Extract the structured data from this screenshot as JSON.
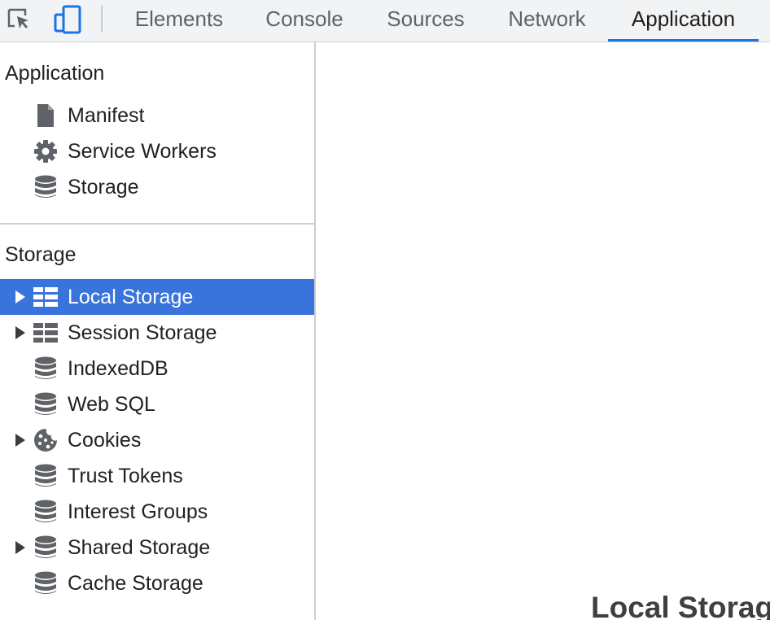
{
  "toolbar": {
    "tabs": [
      {
        "label": "Elements"
      },
      {
        "label": "Console"
      },
      {
        "label": "Sources"
      },
      {
        "label": "Network"
      },
      {
        "label": "Application"
      }
    ],
    "active_tab": "Application",
    "icons": {
      "inspect": "inspect-element-icon",
      "device": "device-toolbar-icon"
    },
    "accent_color": "#1a73e8"
  },
  "sidebar": {
    "application": {
      "title": "Application",
      "items": [
        {
          "label": "Manifest",
          "icon": "document-icon"
        },
        {
          "label": "Service Workers",
          "icon": "gear-icon"
        },
        {
          "label": "Storage",
          "icon": "database-icon"
        }
      ]
    },
    "storage": {
      "title": "Storage",
      "items": [
        {
          "label": "Local Storage",
          "icon": "table-icon",
          "expandable": true,
          "selected": true
        },
        {
          "label": "Session Storage",
          "icon": "table-icon",
          "expandable": true
        },
        {
          "label": "IndexedDB",
          "icon": "database-icon"
        },
        {
          "label": "Web SQL",
          "icon": "database-icon"
        },
        {
          "label": "Cookies",
          "icon": "cookie-icon",
          "expandable": true
        },
        {
          "label": "Trust Tokens",
          "icon": "database-icon"
        },
        {
          "label": "Interest Groups",
          "icon": "database-icon"
        },
        {
          "label": "Shared Storage",
          "icon": "database-icon",
          "expandable": true
        },
        {
          "label": "Cache Storage",
          "icon": "database-icon"
        }
      ]
    },
    "selection_color": "#3874dc"
  },
  "main": {
    "heading": "Local Storage"
  }
}
